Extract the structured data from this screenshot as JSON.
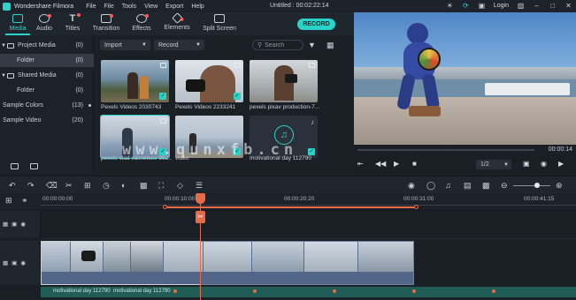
{
  "app": {
    "name": "Wondershare Filmora",
    "menu": [
      "File",
      "File",
      "Tools",
      "View",
      "Export",
      "Help"
    ],
    "project_title": "Untitled : 00:02:22:14",
    "login_label": "Login",
    "accent_color": "#2ad3c7",
    "playhead_color": "#e86b47"
  },
  "toolbar": {
    "tabs": [
      {
        "label": "Media",
        "icon": "media-folder-icon",
        "active": true,
        "badge": false
      },
      {
        "label": "Audio",
        "icon": "music-note-icon",
        "active": false,
        "badge": true
      },
      {
        "label": "Titles",
        "icon": "titles-t-icon",
        "active": false,
        "badge": true
      },
      {
        "label": "Transition",
        "icon": "transition-icon",
        "active": false,
        "badge": true
      },
      {
        "label": "Effects",
        "icon": "effects-sparkle-icon",
        "active": false,
        "badge": true
      },
      {
        "label": "Elements",
        "icon": "elements-icon",
        "active": false,
        "badge": true
      },
      {
        "label": "Split Screen",
        "icon": "split-screen-icon",
        "active": false,
        "badge": false
      }
    ],
    "record_label": "RECORD"
  },
  "sidebar": {
    "items": [
      {
        "label": "Project Media",
        "count": "(0)",
        "expandable": true,
        "selected": false
      },
      {
        "label": "Folder",
        "count": "(0)",
        "expandable": false,
        "selected": true
      },
      {
        "label": "Shared Media",
        "count": "(0)",
        "expandable": true,
        "selected": false
      },
      {
        "label": "Folder",
        "count": "(0)",
        "expandable": false,
        "selected": false
      },
      {
        "label": "Sample Colors",
        "count": "(13)",
        "expandable": false,
        "selected": false
      },
      {
        "label": "Sample Video",
        "count": "(20)",
        "expandable": false,
        "selected": false
      }
    ]
  },
  "media": {
    "import_label": "Import",
    "record_label": "Record",
    "search_placeholder": "Search",
    "items": [
      {
        "label": "Pexels Videos 2030743",
        "selected": false
      },
      {
        "label": "Pexels Videos 2233241",
        "selected": false
      },
      {
        "label": "pexels pixav production-7...",
        "selected": false
      },
      {
        "label": "pexels vlad vasnetsov 992...",
        "selected": true
      },
      {
        "label": "video",
        "selected": false
      },
      {
        "label": "motivational day 112790",
        "selected": false
      }
    ]
  },
  "preview": {
    "timecode": "00:00:14",
    "ratio": "1/2"
  },
  "timeline": {
    "ruler_times": [
      "00:00:00:00",
      "00:00:10:00",
      "00:00:20:20",
      "00:00:31:00",
      "00:00:41:15"
    ],
    "audio_clips": [
      "motivational day 112790",
      "motivational day 112790"
    ]
  },
  "watermark": "www.qunxfb.cn"
}
